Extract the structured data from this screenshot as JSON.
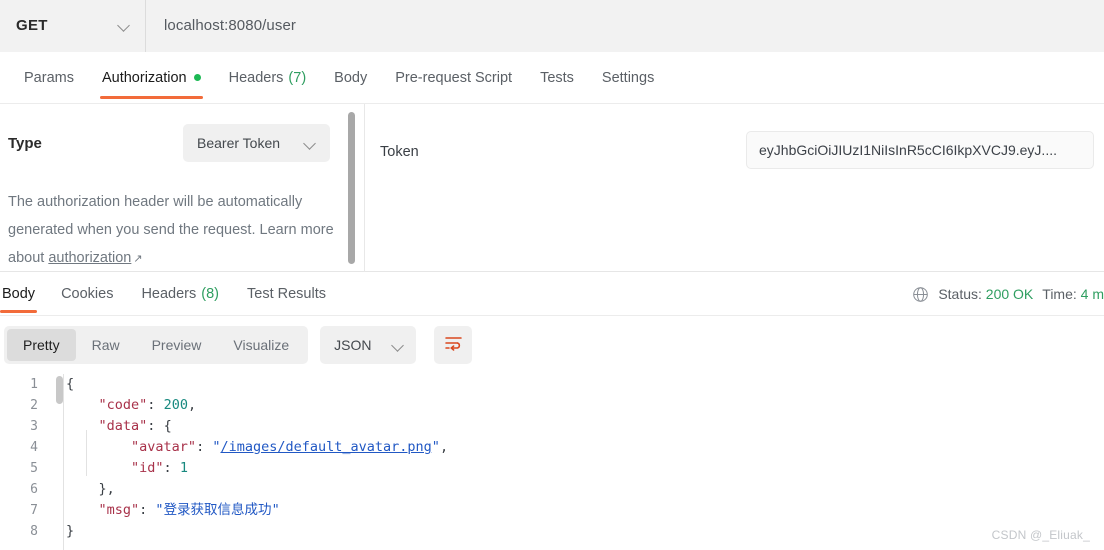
{
  "request_bar": {
    "method": "GET",
    "method_caret": "chevron-down",
    "url": "localhost:8080/user"
  },
  "request_tabs": [
    {
      "label": "Params",
      "active": false
    },
    {
      "label": "Authorization",
      "active": true,
      "dot": true
    },
    {
      "label": "Headers",
      "count": "(7)",
      "active": false
    },
    {
      "label": "Body",
      "active": false
    },
    {
      "label": "Pre-request Script",
      "active": false
    },
    {
      "label": "Tests",
      "active": false
    },
    {
      "label": "Settings",
      "active": false
    }
  ],
  "auth": {
    "type_label": "Type",
    "type_value": "Bearer Token",
    "description_line1": "The authorization header will be automatically",
    "description_line2": "generated when you send the request. Learn",
    "description_line3_pre": "more about ",
    "description_link": "authorization",
    "external_arrow": "↗",
    "token_label": "Token",
    "token_value": "eyJhbGciOiJIUzI1NiIsInR5cCI6IkpXVCJ9.eyJ...."
  },
  "response_tabs": [
    {
      "label": "Body",
      "active": true
    },
    {
      "label": "Cookies",
      "active": false
    },
    {
      "label": "Headers",
      "count": "(8)",
      "active": false
    },
    {
      "label": "Test Results",
      "active": false
    }
  ],
  "response_status": {
    "globe_icon": "globe-icon",
    "status_prefix": "Status:",
    "status_value": "200 OK",
    "time_prefix": "Time:",
    "time_value": "4 m"
  },
  "view_toolbar": {
    "modes": [
      {
        "label": "Pretty",
        "active": true
      },
      {
        "label": "Raw",
        "active": false
      },
      {
        "label": "Preview",
        "active": false
      },
      {
        "label": "Visualize",
        "active": false
      }
    ],
    "format": "JSON",
    "wrap_icon": "word-wrap-icon"
  },
  "response_body": {
    "language": "json",
    "lines": [
      {
        "n": "1",
        "tokens": [
          {
            "t": "{",
            "c": "k-punc"
          }
        ]
      },
      {
        "n": "2",
        "tokens": [
          {
            "t": "    ",
            "c": "k-punc"
          },
          {
            "t": "\"code\"",
            "c": "k-key"
          },
          {
            "t": ": ",
            "c": "k-punc"
          },
          {
            "t": "200",
            "c": "k-num"
          },
          {
            "t": ",",
            "c": "k-punc"
          }
        ]
      },
      {
        "n": "3",
        "tokens": [
          {
            "t": "    ",
            "c": "k-punc"
          },
          {
            "t": "\"data\"",
            "c": "k-key"
          },
          {
            "t": ": ",
            "c": "k-punc"
          },
          {
            "t": "{",
            "c": "k-punc"
          }
        ]
      },
      {
        "n": "4",
        "tokens": [
          {
            "t": "        ",
            "c": "k-punc"
          },
          {
            "t": "\"avatar\"",
            "c": "k-key"
          },
          {
            "t": ": ",
            "c": "k-punc"
          },
          {
            "t": "\"",
            "c": "k-str"
          },
          {
            "t": "/images/default_avatar.png",
            "c": "k-link"
          },
          {
            "t": "\"",
            "c": "k-str"
          },
          {
            "t": ",",
            "c": "k-punc"
          }
        ]
      },
      {
        "n": "5",
        "tokens": [
          {
            "t": "        ",
            "c": "k-punc"
          },
          {
            "t": "\"id\"",
            "c": "k-key"
          },
          {
            "t": ": ",
            "c": "k-punc"
          },
          {
            "t": "1",
            "c": "k-num"
          }
        ]
      },
      {
        "n": "6",
        "tokens": [
          {
            "t": "    ",
            "c": "k-punc"
          },
          {
            "t": "},",
            "c": "k-punc"
          }
        ]
      },
      {
        "n": "7",
        "tokens": [
          {
            "t": "    ",
            "c": "k-punc"
          },
          {
            "t": "\"msg\"",
            "c": "k-key"
          },
          {
            "t": ": ",
            "c": "k-punc"
          },
          {
            "t": "\"",
            "c": "k-str"
          },
          {
            "t": "登录获取信息成功",
            "c": "k-cjk"
          },
          {
            "t": "\"",
            "c": "k-str"
          }
        ]
      },
      {
        "n": "8",
        "tokens": [
          {
            "t": "}",
            "c": "k-punc"
          }
        ]
      }
    ]
  },
  "watermark": "CSDN @_Eliuak_",
  "colors": {
    "accent_orange": "#f26b3a",
    "success_green": "#2f9e60",
    "dot_green": "#1db954",
    "json_key": "#a8324a",
    "json_number": "#18897f",
    "json_string": "#2158c4",
    "toolbar_bg": "#f0f0f0"
  }
}
